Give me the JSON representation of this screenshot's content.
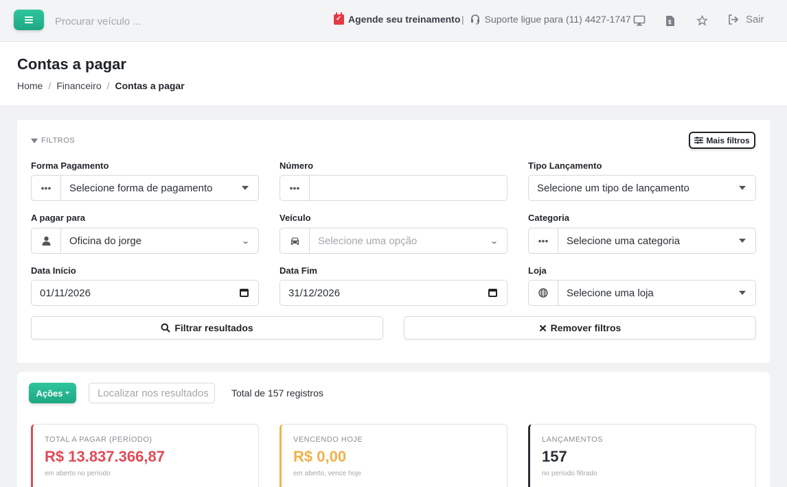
{
  "colors": {
    "accent": "#22b38a",
    "danger": "#e04a57",
    "warning": "#f0b24a",
    "neutral": "#2b2f36"
  },
  "topbar": {
    "search_placeholder": "Procurar veículo ...",
    "agenda_label": "Agende seu treinamento",
    "support_label": "Suporte ligue para (11) 4427-1747",
    "logout_label": "Sair"
  },
  "header": {
    "title": "Contas a pagar",
    "breadcrumb": [
      "Home",
      "Financeiro",
      "Contas a pagar"
    ]
  },
  "filters": {
    "section_label": "FILTROS",
    "more_button": "Mais filtros",
    "forma_pagamento": {
      "label": "Forma Pagamento",
      "value": "Selecione forma de pagamento"
    },
    "numero": {
      "label": "Número",
      "value": ""
    },
    "tipo_lancamento": {
      "label": "Tipo Lançamento",
      "value": "Selecione um tipo de lançamento"
    },
    "a_pagar_para": {
      "label": "A pagar para",
      "value": "Oficina do jorge"
    },
    "veiculo": {
      "label": "Veículo",
      "placeholder": "Selecione uma opção"
    },
    "categoria": {
      "label": "Categoria",
      "value": "Selecione uma categoria"
    },
    "data_inicio": {
      "label": "Data Início",
      "value": "01/11/2026"
    },
    "data_fim": {
      "label": "Data Fim",
      "value": "31/12/2026"
    },
    "loja": {
      "label": "Loja",
      "value": "Selecione uma loja"
    },
    "filter_button": "Filtrar resultados",
    "remove_button": "Remover filtros"
  },
  "results": {
    "actions_button": "Ações",
    "find_placeholder": "Localizar nos resultados",
    "total_text": "Total de 157 registros",
    "stats": [
      {
        "label": "TOTAL A PAGAR (PERÍODO)",
        "value": "R$ 13.837.366,87",
        "sub": "em aberto no período",
        "color": "#e04a57"
      },
      {
        "label": "VENCENDO HOJE",
        "value": "R$ 0,00",
        "sub": "em aberto, vence hoje",
        "color": "#f0b24a"
      },
      {
        "label": "LANÇAMENTOS",
        "value": "157",
        "sub": "no período filtrado",
        "color": "#2b2f36"
      }
    ]
  }
}
